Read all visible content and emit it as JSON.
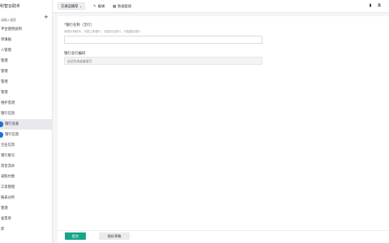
{
  "sidebar": {
    "title": "科智云助手",
    "search_placeholder": "请输入搜索",
    "add_icon": "plus-icon",
    "items": [
      {
        "label": "平台使用说明"
      },
      {
        "label": "单填报"
      },
      {
        "label": "人管理"
      },
      {
        "label": "管理"
      },
      {
        "label": "管理"
      },
      {
        "label": "管理"
      },
      {
        "label": "管理"
      },
      {
        "label": "维护监测"
      },
      {
        "label": "银行信息"
      },
      {
        "label": "银行总表",
        "sub": true,
        "active": true
      },
      {
        "label": "银行信息",
        "sub": true
      },
      {
        "label": "企业信息"
      },
      {
        "label": "银行账号"
      },
      {
        "label": "资金流水"
      },
      {
        "label": "采购付款"
      },
      {
        "label": "工资管理"
      },
      {
        "label": "报表分析"
      },
      {
        "label": "管理"
      },
      {
        "label": "发票单"
      },
      {
        "label": "库"
      }
    ]
  },
  "topbar": {
    "dropdown_label": "交通运输部 ⌄",
    "edit_label": "编辑",
    "edit_icon": "pencil-icon",
    "data_label": "数据管理",
    "data_icon": "grid-icon",
    "right_icons": [
      "panel-icon",
      "expand-icon"
    ]
  },
  "form": {
    "bank_name_label": "*银行名称（全行）",
    "bank_name_hint": "请按示例填写，中国工商银行，中国农业银行，中国建设银行",
    "bank_name_value": "",
    "bank_code_label": "银行总行编码",
    "bank_code_placeholder": "自动生成或者填写",
    "bank_code_value": ""
  },
  "footer": {
    "submit_label": "提交",
    "save_draft_label": "保存草稿"
  }
}
